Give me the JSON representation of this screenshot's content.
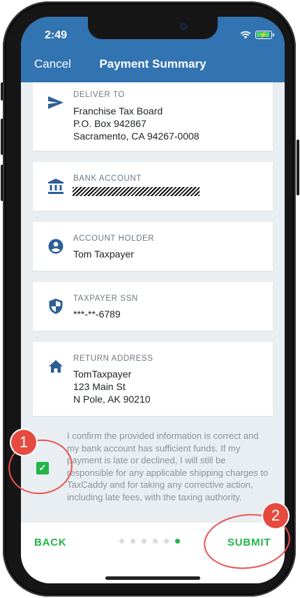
{
  "status_bar": {
    "time": "2:49"
  },
  "header": {
    "cancel": "Cancel",
    "title": "Payment Summary"
  },
  "cards": {
    "deliver_to": {
      "label": "DELIVER TO",
      "lines": [
        "Franchise Tax Board",
        "P.O. Box 942867",
        "Sacramento, CA 94267-0008"
      ],
      "icon": "send-icon"
    },
    "bank_account": {
      "label": "BANK ACCOUNT",
      "icon": "bank-icon"
    },
    "account_holder": {
      "label": "ACCOUNT HOLDER",
      "value": "Tom Taxpayer",
      "icon": "person-icon"
    },
    "taxpayer_ssn": {
      "label": "TAXPAYER SSN",
      "value": "***-**-6789",
      "icon": "shield-icon"
    },
    "return_address": {
      "label": "RETURN ADDRESS",
      "lines": [
        "TomTaxpayer",
        "123 Main St",
        "N Pole, AK 90210"
      ],
      "icon": "home-icon"
    }
  },
  "confirmation": {
    "text": "I confirm the provided information is correct and my bank account has sufficient funds. If my payment is late or declined, I will still be responsible for any applicable shipping charges to TaxCaddy and for taking any corrective action, including late fees, with the taxing authority.",
    "checked": true
  },
  "footer": {
    "back": "BACK",
    "submit": "SUBMIT",
    "pager": {
      "total": 6,
      "active_index": 5
    }
  },
  "annotations": {
    "badge_1": "1",
    "badge_2": "2"
  },
  "colors": {
    "header_blue": "#3273b1",
    "accent_green": "#23b54a",
    "icon_blue": "#2c5f95",
    "annotation_red": "#e64a3f"
  }
}
